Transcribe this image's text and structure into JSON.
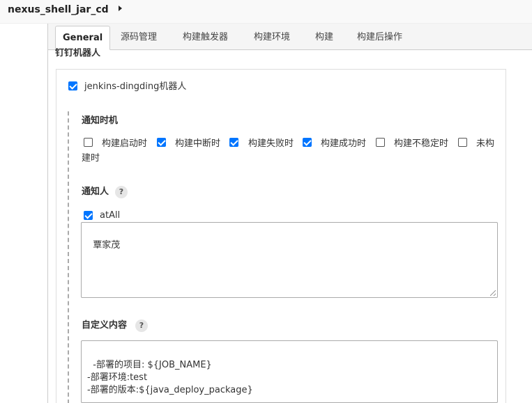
{
  "breadcrumb": {
    "job_name": "nexus_shell_jar_cd"
  },
  "tabs": [
    "General",
    "源码管理",
    "构建触发器",
    "构建环境",
    "构建",
    "构建后操作"
  ],
  "active_tab": "General",
  "section": {
    "title": "钉钉机器人"
  },
  "robot": {
    "label": "jenkins-dingding机器人",
    "checked": true
  },
  "notify_timing": {
    "title": "通知时机",
    "options": [
      {
        "label": "构建启动时",
        "checked": false
      },
      {
        "label": "构建中断时",
        "checked": true
      },
      {
        "label": "构建失败时",
        "checked": true
      },
      {
        "label": "构建成功时",
        "checked": true
      },
      {
        "label": "构建不稳定时",
        "checked": false
      },
      {
        "label_line1": "未构",
        "label_line2": "建时",
        "checked": false
      }
    ]
  },
  "notify_people": {
    "title": "通知人",
    "help": "?",
    "at_all": {
      "label": "atAll",
      "checked": true
    },
    "value": "覃家茂"
  },
  "custom_content": {
    "title": "自定义内容",
    "help": "?",
    "value": "-部署的项目: ${JOB_NAME}\n-部署环境:test\n-部署的版本:${java_deploy_package}"
  },
  "colors": {
    "checkbox_accent": "#0075ff"
  }
}
